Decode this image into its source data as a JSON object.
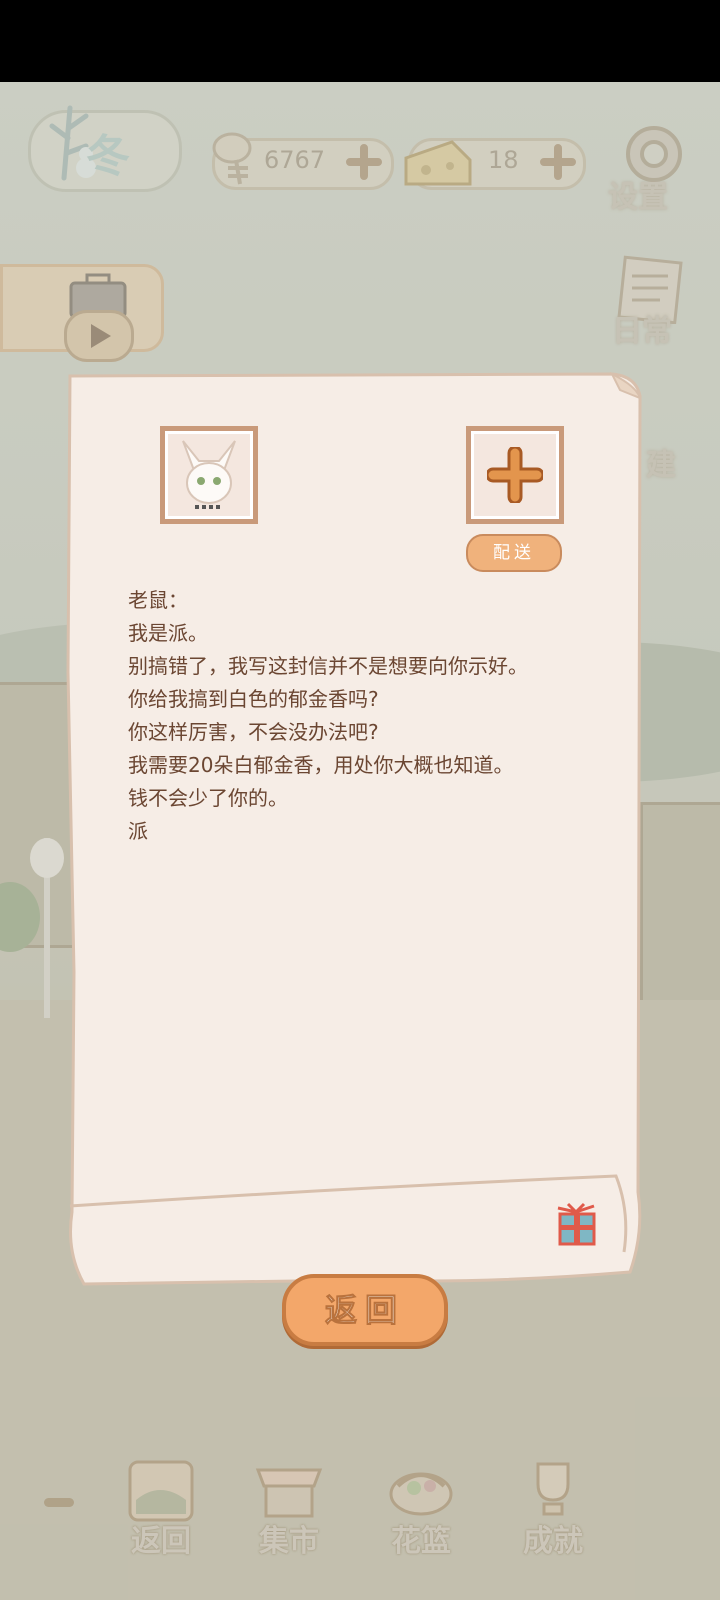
{
  "hud": {
    "season": "冬",
    "fish_count": "6767",
    "cheese_count": "18",
    "settings_label": "设置",
    "daily_label": "日常",
    "build_label": "建"
  },
  "letter": {
    "deliver_label": "配送",
    "lines": [
      "老鼠：",
      "我是派。",
      "别搞错了，我写这封信并不是想要向你示好。",
      "你给我搞到白色的郁金香吗?",
      "你这样厉害，不会没办法吧?",
      "我需要20朵白郁金香，用处你大概也知道。",
      "钱不会少了你的。",
      "派"
    ],
    "back_label": "返回"
  },
  "bottom_nav": {
    "items": [
      {
        "label": "返回",
        "icon": "window-icon"
      },
      {
        "label": "集市",
        "icon": "market-stall-icon"
      },
      {
        "label": "花篮",
        "icon": "flower-basket-icon"
      },
      {
        "label": "成就",
        "icon": "trophy-icon"
      }
    ]
  },
  "colors": {
    "letter_text": "#6b4632",
    "button_orange": "#f3a76a",
    "button_border": "#c87c42"
  }
}
